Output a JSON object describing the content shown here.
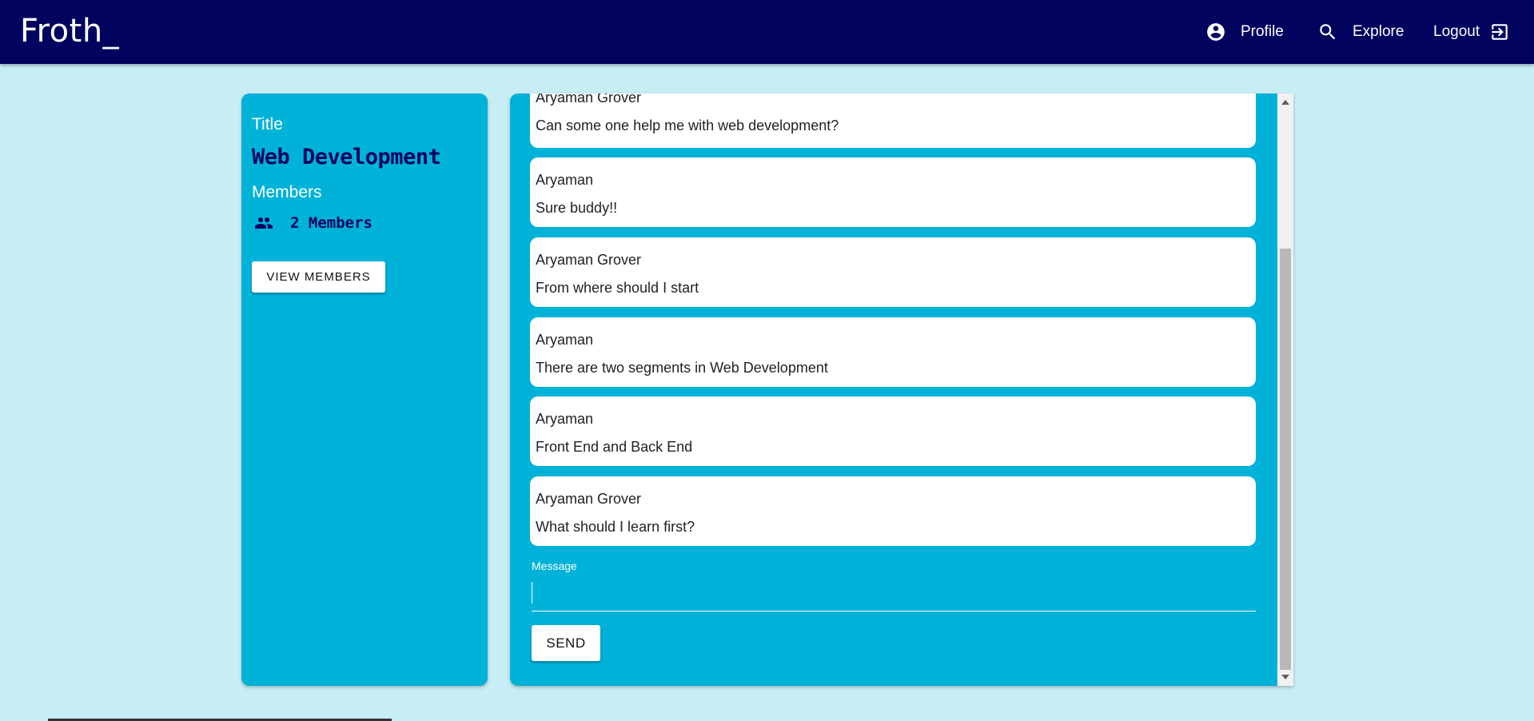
{
  "app": {
    "brand": "Froth_"
  },
  "nav": {
    "profile": "Profile",
    "explore": "Explore",
    "logout": "Logout"
  },
  "group": {
    "title_caption": "Title",
    "title_value": "Web Development",
    "members_caption": "Members",
    "members_count": "2 Members",
    "view_members_button": "VIEW MEMBERS"
  },
  "messages": [
    {
      "author": "Aryaman Grover",
      "text": "Can some one help me with web development?"
    },
    {
      "author": "Aryaman",
      "text": "Sure buddy!!"
    },
    {
      "author": "Aryaman Grover",
      "text": "From where should I start"
    },
    {
      "author": "Aryaman",
      "text": "There are two segments in Web Development"
    },
    {
      "author": "Aryaman",
      "text": "Front End and Back End"
    },
    {
      "author": "Aryaman Grover",
      "text": "What should I learn first?"
    }
  ],
  "composer": {
    "label": "Message",
    "value": "",
    "send_button": "SEND"
  },
  "icons": {
    "profile": "account-circle-icon",
    "explore": "search-icon",
    "logout": "logout-icon",
    "members": "people-icon"
  },
  "colors": {
    "appbar": "#02035f",
    "background": "#c8eef5",
    "panel": "#00b2d8",
    "accent_text": "#02035f"
  }
}
